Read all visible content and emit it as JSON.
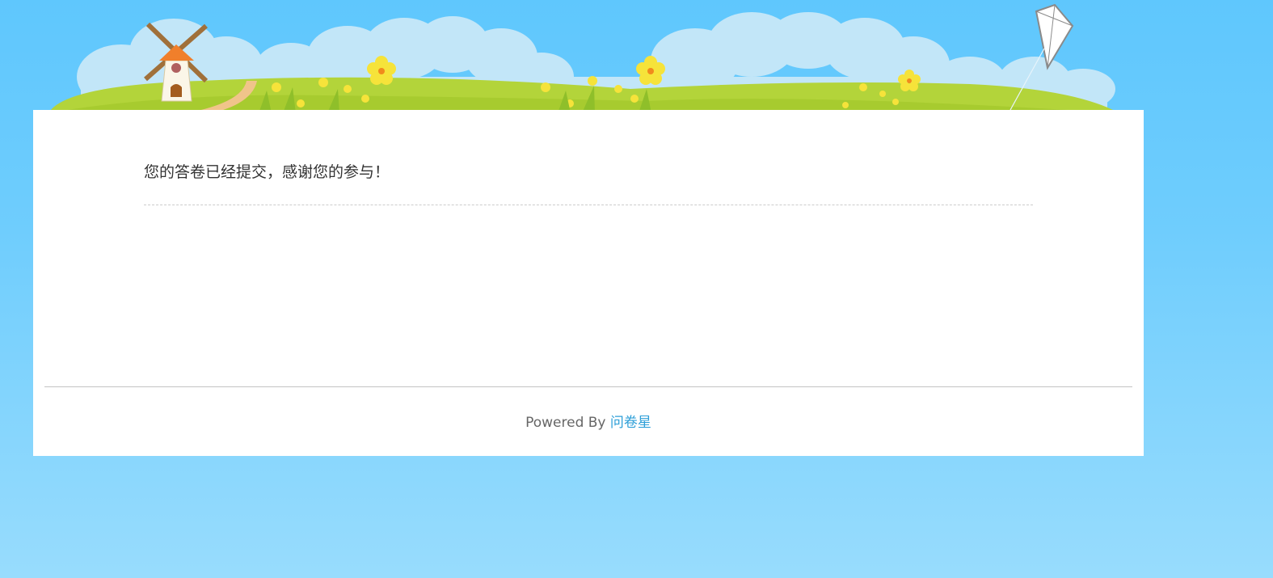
{
  "completion": {
    "message": "您的答卷已经提交，感谢您的参与！"
  },
  "footer": {
    "powered_by": "Powered By",
    "brand_link": "问卷星"
  },
  "colors": {
    "sky": "#5fc7fd",
    "card": "#ffffff",
    "link": "#2e9fd8"
  }
}
